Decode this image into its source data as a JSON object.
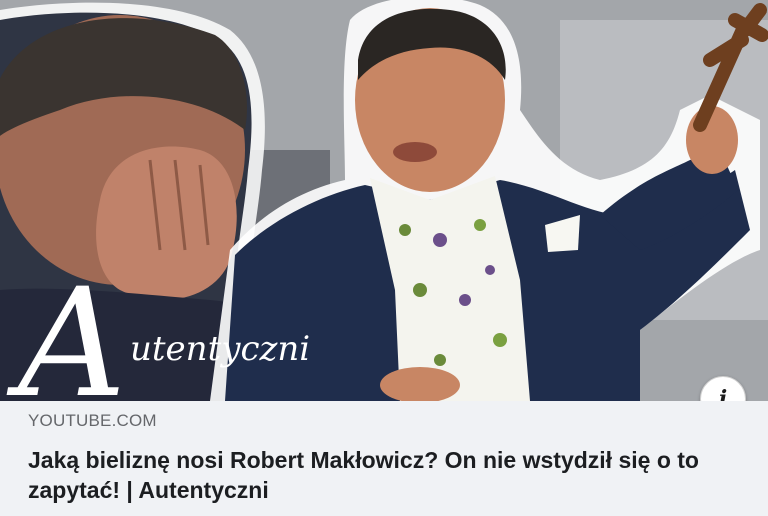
{
  "thumbnail": {
    "overlay_logo_letter": "A",
    "overlay_logo_text": "utentyczni"
  },
  "link_preview": {
    "source": "YOUTUBE.COM",
    "title": "Jaką bieliznę nosi Robert Makłowicz? On nie wstydził się o to zapytać! | Autentyczni"
  },
  "info_button": {
    "icon": "info-icon",
    "glyph": "i"
  },
  "colors": {
    "link_bar_bg": "#f0f2f5",
    "source_text": "#65676b",
    "title_text": "#1c1e21"
  }
}
